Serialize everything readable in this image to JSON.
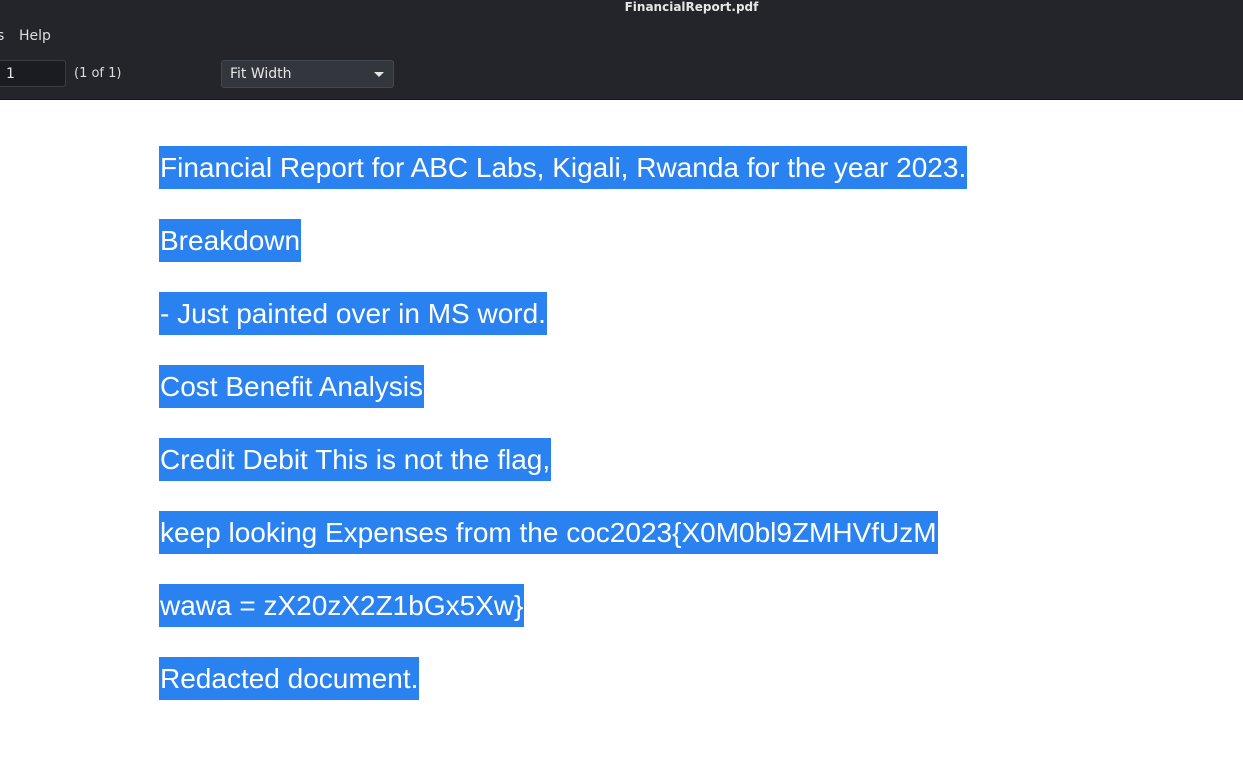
{
  "window": {
    "title": "FinancialReport.pdf"
  },
  "menubar": {
    "partial_item": "s",
    "help": "Help"
  },
  "toolbar": {
    "page_number_value": "1",
    "page_count": "(1 of 1)",
    "zoom_selected": "Fit Width"
  },
  "document": {
    "selection_color": "#2a82f0",
    "lines": [
      "Financial Report for ABC Labs, Kigali, Rwanda for the year 2023.",
      "Breakdown",
      "- Just painted over in MS word.",
      "Cost Benefit Analysis",
      "Credit Debit This is not the flag,",
      "keep looking Expenses from the coc2023{X0M0bl9ZMHVfUzM",
      "wawa = zX20zX2Z1bGx5Xw}",
      "Redacted document."
    ]
  }
}
